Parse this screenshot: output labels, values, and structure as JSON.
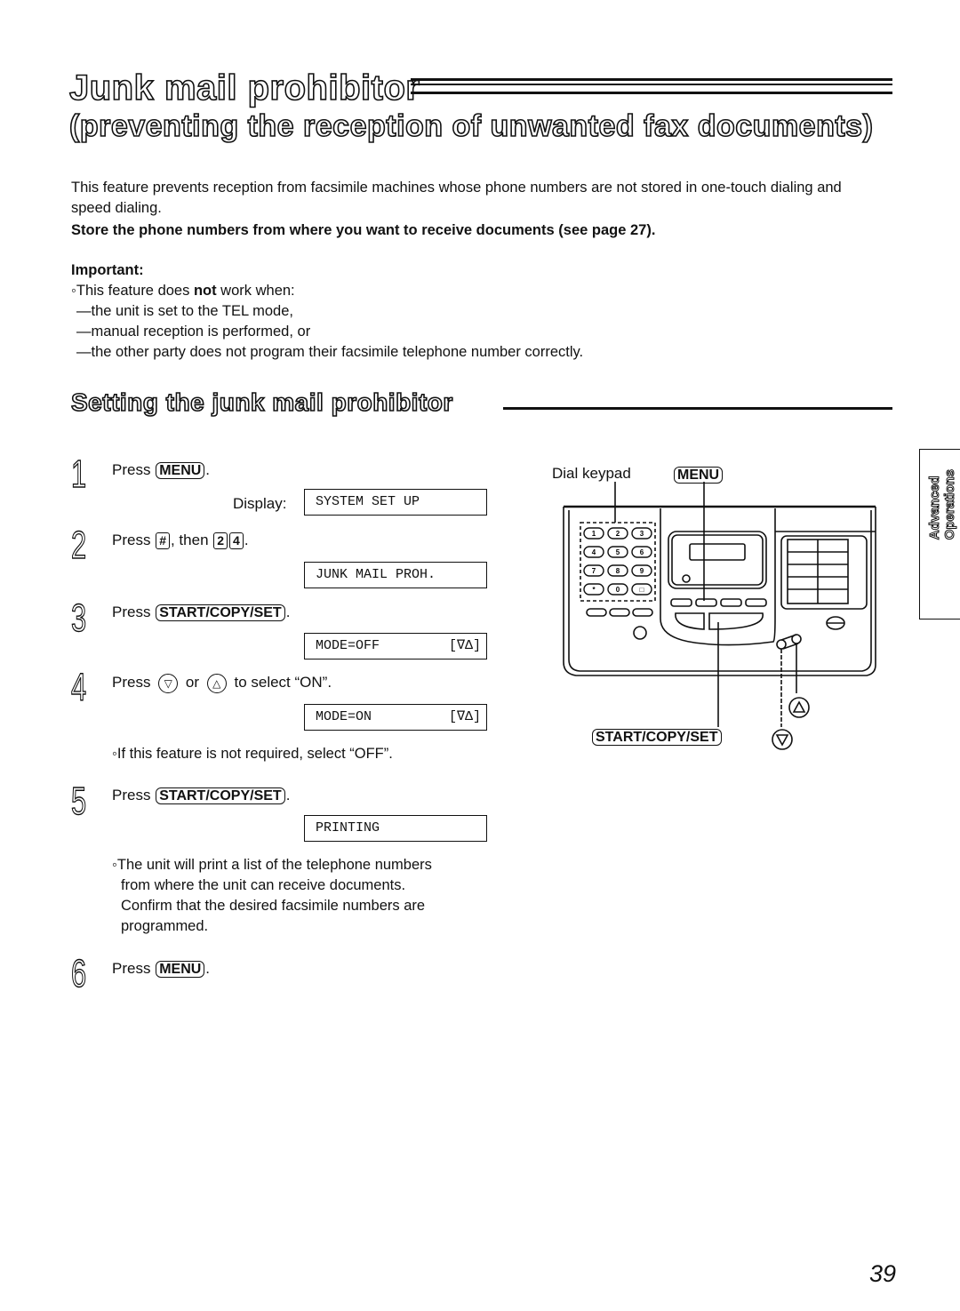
{
  "header": {
    "title": "Junk mail prohibitor",
    "subtitle": "(preventing the reception of unwanted fax documents)"
  },
  "intro": {
    "paragraph": "This feature prevents reception from facsimile machines whose phone numbers are not stored in one-touch dialing and speed dialing.",
    "bold_instruction": "Store the phone numbers from where you want to receive documents (see page 27).",
    "important_label": "Important:",
    "important_lead": "This feature does ",
    "important_bold": "not",
    "important_tail": " work when:",
    "conditions": [
      "—the unit is set to the TEL mode,",
      "—manual reception is performed, or",
      "—the other party does not program their facsimile telephone number correctly."
    ]
  },
  "section": {
    "title": "Setting the junk mail prohibitor"
  },
  "steps": [
    {
      "num": "1",
      "prefix": "Press ",
      "key": "MENU",
      "suffix": ".",
      "display_label": "Display:",
      "display": "SYSTEM SET UP"
    },
    {
      "num": "2",
      "prefix": "Press ",
      "key_hash": "#",
      "middle": ", then ",
      "key_a": "2",
      "key_b": "4",
      "suffix": ".",
      "display": "JUNK MAIL PROH."
    },
    {
      "num": "3",
      "prefix": "Press ",
      "key": "START/COPY/SET",
      "suffix": ".",
      "display": "MODE=OFF",
      "display_arrows": "[∇Δ]"
    },
    {
      "num": "4",
      "prefix": "Press ",
      "down": "▽",
      "or": " or ",
      "up": "△",
      "suffix": " to select “ON”.",
      "display": "MODE=ON",
      "display_arrows": "[∇Δ]",
      "note": "If this feature is not required, select “OFF”."
    },
    {
      "num": "5",
      "prefix": "Press ",
      "key": "START/COPY/SET",
      "suffix": ".",
      "display": "PRINTING",
      "note_lines": [
        "The unit will print a list of the telephone numbers",
        "from where the unit can receive documents.",
        "Confirm that the desired facsimile numbers are",
        "programmed."
      ]
    },
    {
      "num": "6",
      "prefix": "Press ",
      "key": "MENU",
      "suffix": "."
    }
  ],
  "diagram": {
    "label_dial_keypad": "Dial keypad",
    "label_menu": "MENU",
    "label_start": "START/COPY/SET",
    "up_arrow": "△",
    "down_arrow": "▽",
    "keypad": [
      "1",
      "2",
      "3",
      "4",
      "5",
      "6",
      "7",
      "8",
      "9",
      "*",
      "0",
      "□"
    ]
  },
  "side_tab": {
    "line1": "Advanced",
    "line2": "Operations"
  },
  "footer": {
    "page_number": "39"
  }
}
